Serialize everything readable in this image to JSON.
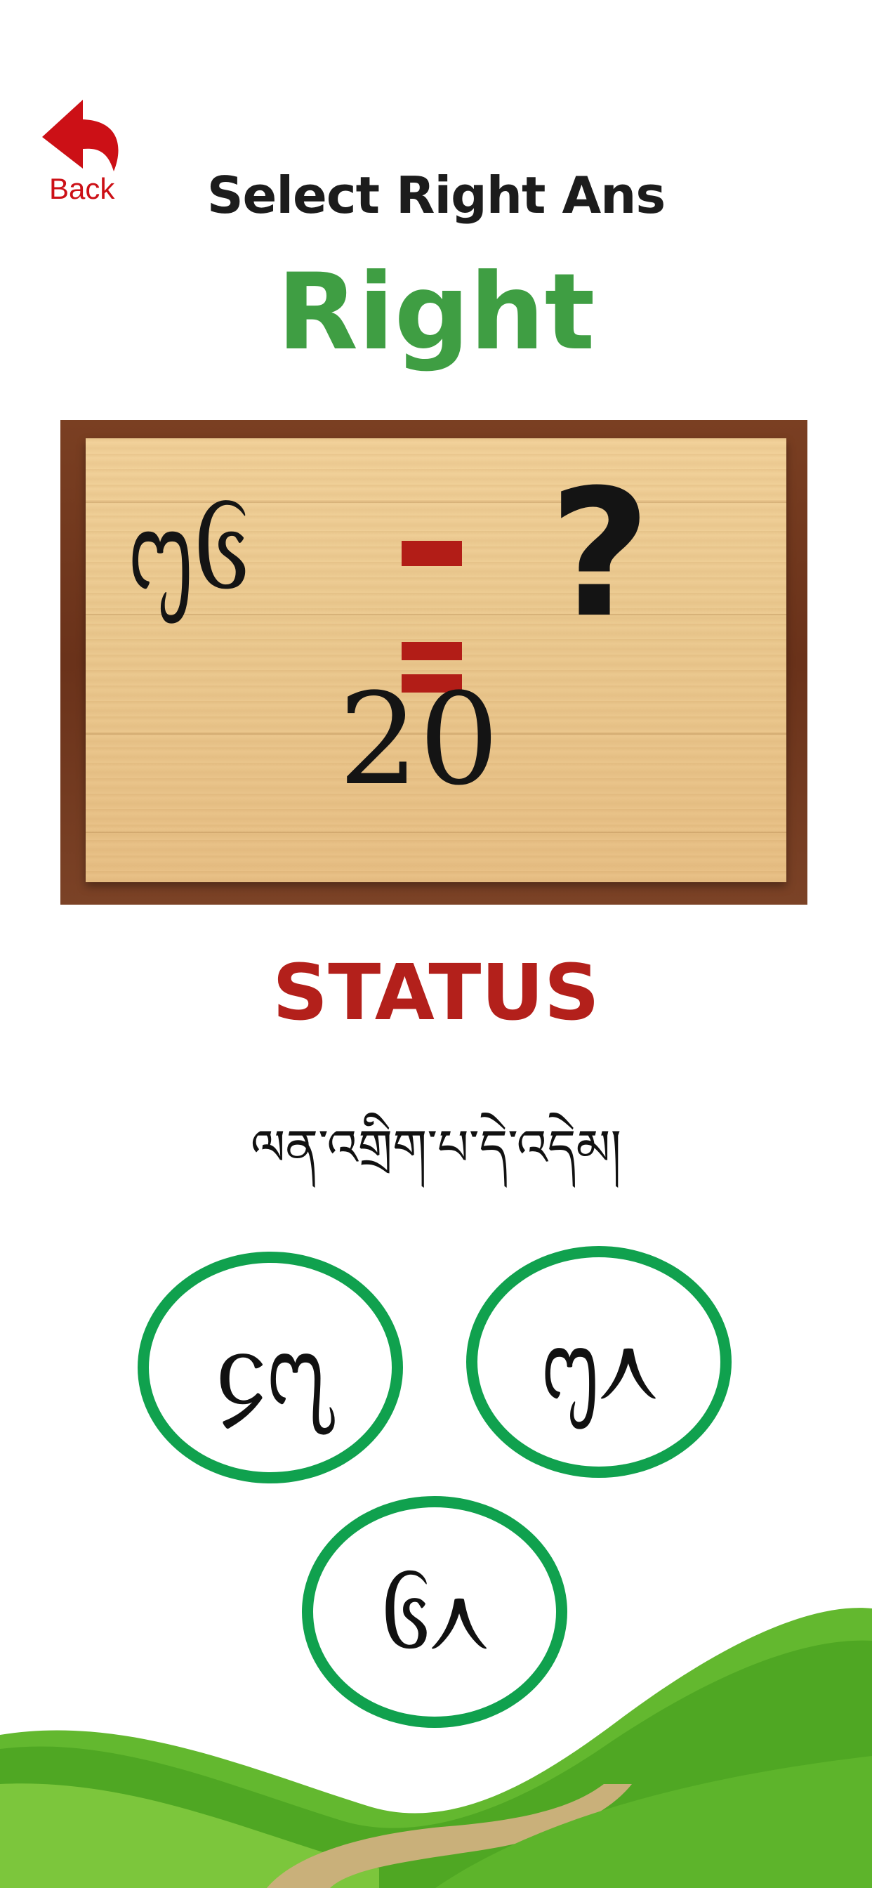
{
  "back": {
    "label": "Back"
  },
  "header": {
    "title": "Select Right Ans",
    "result": "Right"
  },
  "board": {
    "operand": "᧕᧖",
    "question_mark": "?",
    "answer_value": "20"
  },
  "status": {
    "label": "STATUS",
    "message": "ལན་འགྲིག་པ་དེ་འདེམ།"
  },
  "options": [
    {
      "label": "᧔᧗"
    },
    {
      "label": "᧕᧘"
    },
    {
      "label": "᧖᧘"
    }
  ],
  "colors": {
    "back_red": "#cc1016",
    "result_green": "#3f9e43",
    "status_red": "#b3201b",
    "option_ring": "#10a14e",
    "operator_red": "#b21d17"
  }
}
